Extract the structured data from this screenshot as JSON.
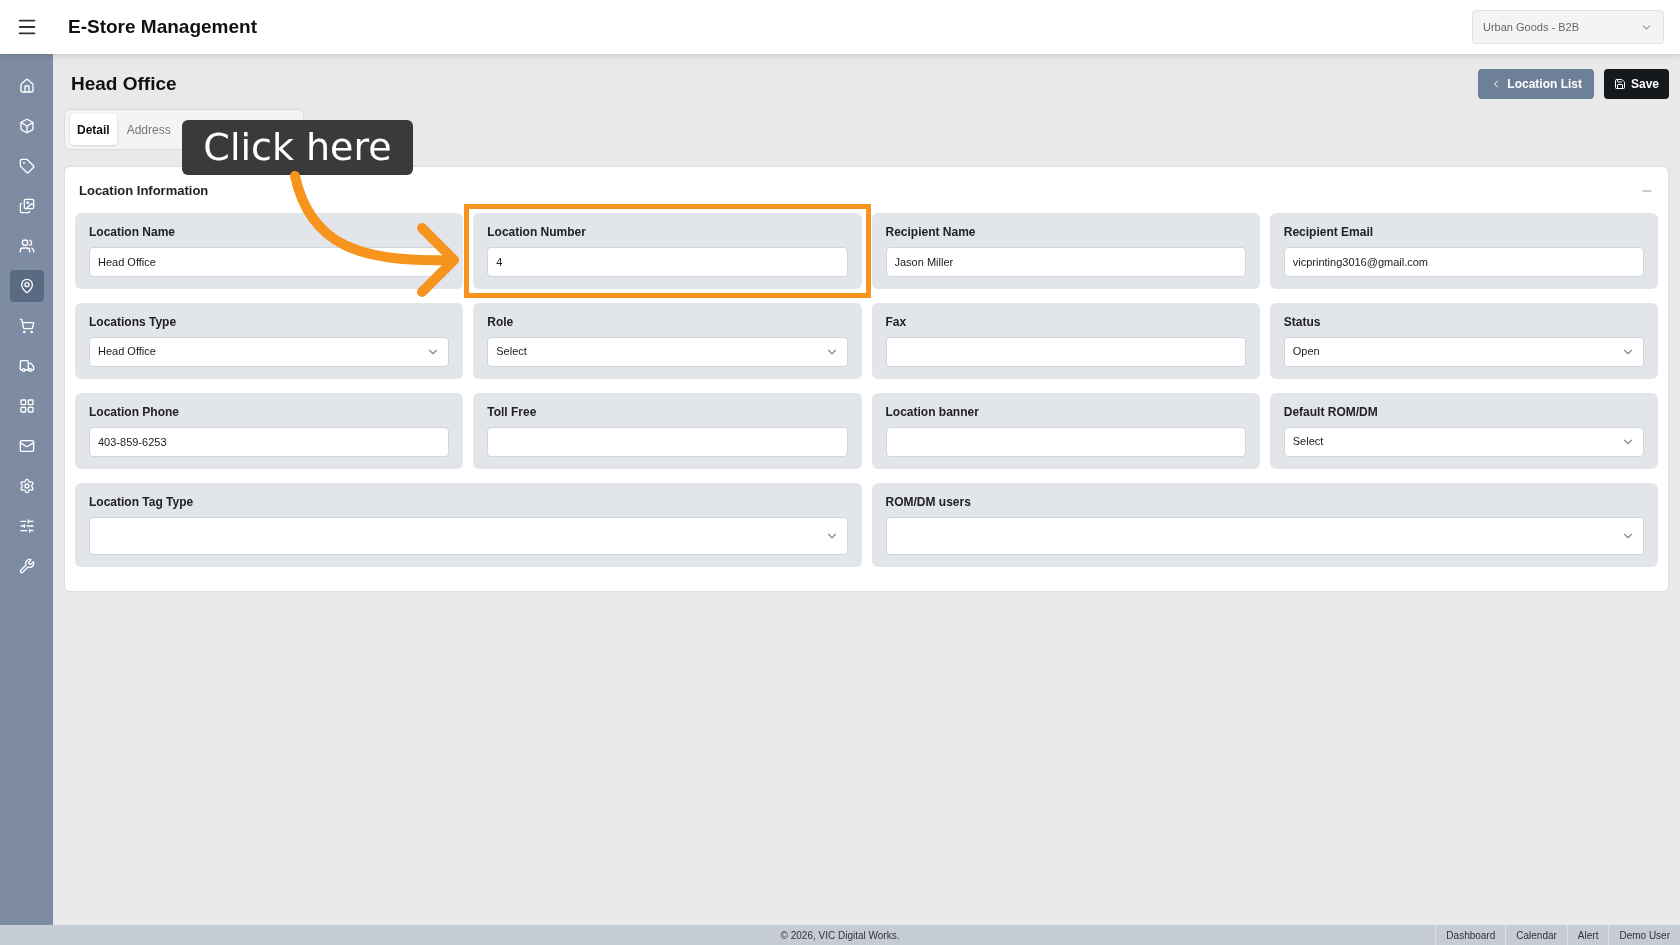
{
  "app": {
    "title": "E-Store Management",
    "store_select": "Urban Goods - B2B"
  },
  "sidebar": {
    "items": [
      {
        "selected": false
      },
      {
        "selected": false
      },
      {
        "selected": false
      },
      {
        "selected": false
      },
      {
        "selected": false
      },
      {
        "selected": true
      },
      {
        "selected": false
      },
      {
        "selected": false
      },
      {
        "selected": false
      },
      {
        "selected": false
      },
      {
        "selected": false
      },
      {
        "selected": false
      },
      {
        "selected": false
      }
    ]
  },
  "page": {
    "title": "Head Office",
    "buttons": [
      {
        "kind": "back",
        "label": "Location List"
      },
      {
        "kind": "save",
        "label": "Save"
      }
    ]
  },
  "tabs": [
    {
      "label": "Detail",
      "selected": true
    },
    {
      "label": "Address",
      "selected": false
    }
  ],
  "annotation": {
    "text": "Click here"
  },
  "section": {
    "title": "Location Information",
    "fields": [
      {
        "label": "Location Name",
        "kind": "text",
        "value": "Head Office",
        "wide": false,
        "highlighted": false
      },
      {
        "label": "Location Number",
        "kind": "text",
        "value": "4",
        "wide": false,
        "highlighted": true
      },
      {
        "label": "Recipient Name",
        "kind": "text",
        "value": "Jason Miller",
        "wide": false,
        "highlighted": false
      },
      {
        "label": "Recipient Email",
        "kind": "text",
        "value": "vicprinting3016@gmail.com",
        "wide": false,
        "highlighted": false
      },
      {
        "label": "Locations Type",
        "kind": "select",
        "value": "Head Office",
        "wide": false,
        "highlighted": false
      },
      {
        "label": "Role",
        "kind": "select",
        "value": "Select",
        "wide": false,
        "highlighted": false
      },
      {
        "label": "Fax",
        "kind": "text",
        "wide": false,
        "highlighted": false
      },
      {
        "label": "Status",
        "kind": "select",
        "value": "Open",
        "wide": false,
        "highlighted": false
      },
      {
        "label": "Location Phone",
        "kind": "text",
        "value": "403-859-6253",
        "wide": false,
        "highlighted": false
      },
      {
        "label": "Toll Free",
        "kind": "text",
        "wide": false,
        "highlighted": false
      },
      {
        "label": "Location banner",
        "kind": "text",
        "wide": false,
        "highlighted": false
      },
      {
        "label": "Default ROM/DM",
        "kind": "select",
        "value": "Select",
        "wide": false,
        "highlighted": false
      },
      {
        "label": "Location Tag Type",
        "kind": "select",
        "wide": true,
        "highlighted": false
      },
      {
        "label": "ROM/DM users",
        "kind": "select",
        "wide": true,
        "highlighted": false
      }
    ]
  },
  "footer": {
    "copyright": "© 2026, VIC Digital Works.",
    "links": [
      "Dashboard",
      "Calendar",
      "Alert",
      "Demo User"
    ]
  }
}
